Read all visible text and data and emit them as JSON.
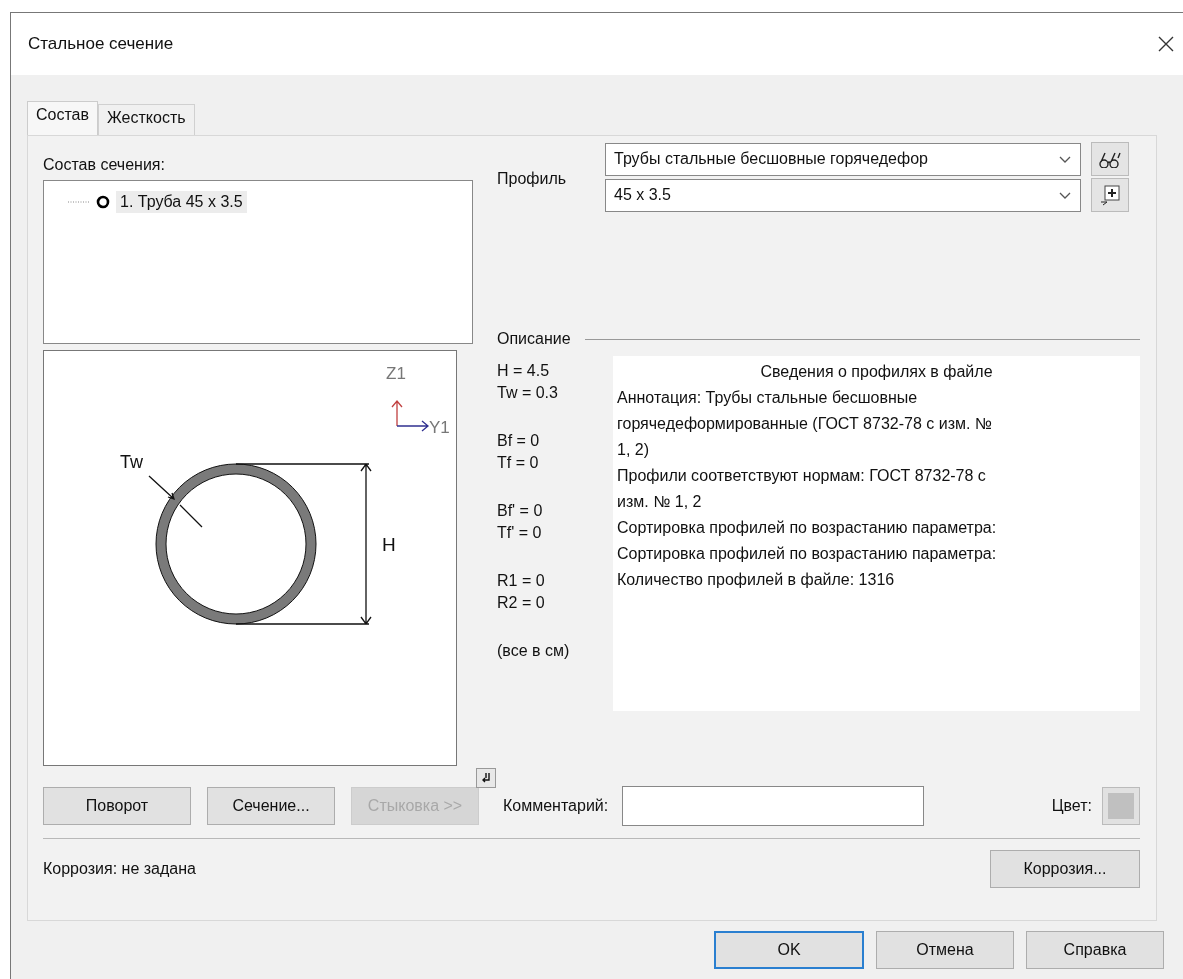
{
  "window": {
    "title": "Стальное сечение"
  },
  "tabs": [
    {
      "label": "Состав",
      "selected": true
    },
    {
      "label": "Жесткость",
      "selected": false
    }
  ],
  "composition": {
    "label": "Состав сечения:",
    "items": [
      {
        "label": "1. Труба 45 x 3.5",
        "selected": true
      }
    ]
  },
  "drawing": {
    "axis_z": "Z1",
    "axis_y": "Y1",
    "wall_label": "Tw",
    "height_label": "H"
  },
  "profile": {
    "label": "Профиль",
    "family": "Трубы стальные бесшовные горячедефор",
    "size": "45 x 3.5"
  },
  "description": {
    "label": "Описание",
    "params": [
      [
        "H = 4.5",
        "Tw = 0.3"
      ],
      [
        "Bf = 0",
        "Tf = 0"
      ],
      [
        "Bf' = 0",
        "Tf' = 0"
      ],
      [
        "R1 = 0",
        "R2 = 0"
      ],
      [
        "(все в см)"
      ]
    ],
    "info_title": "Сведения о профилях в файле",
    "info_lines": [
      "Аннотация: Трубы стальные бесшовные",
      "горячедеформированные (ГОСТ 8732-78 с изм. №",
      "1, 2)",
      "Профили соответствуют нормам: ГОСТ 8732-78 с",
      "изм. № 1, 2",
      "Сортировка профилей по возрастанию параметра:",
      "Сортировка профилей по возрастанию параметра:",
      "Количество профилей в файле: 1316"
    ]
  },
  "actions": [
    {
      "label": "Поворот",
      "disabled": false
    },
    {
      "label": "Сечение...",
      "disabled": false
    },
    {
      "label": "Стыковка >>",
      "disabled": true
    }
  ],
  "comment": {
    "label": "Комментарий:"
  },
  "color": {
    "label": "Цвет:",
    "color": "#c0c0c0"
  },
  "corrosion": {
    "status": "Коррозия: не задана",
    "button": "Коррозия..."
  },
  "footer_buttons": [
    {
      "label": "OK",
      "default": true
    },
    {
      "label": "Отмена",
      "default": false
    },
    {
      "label": "Справка",
      "default": false
    }
  ]
}
